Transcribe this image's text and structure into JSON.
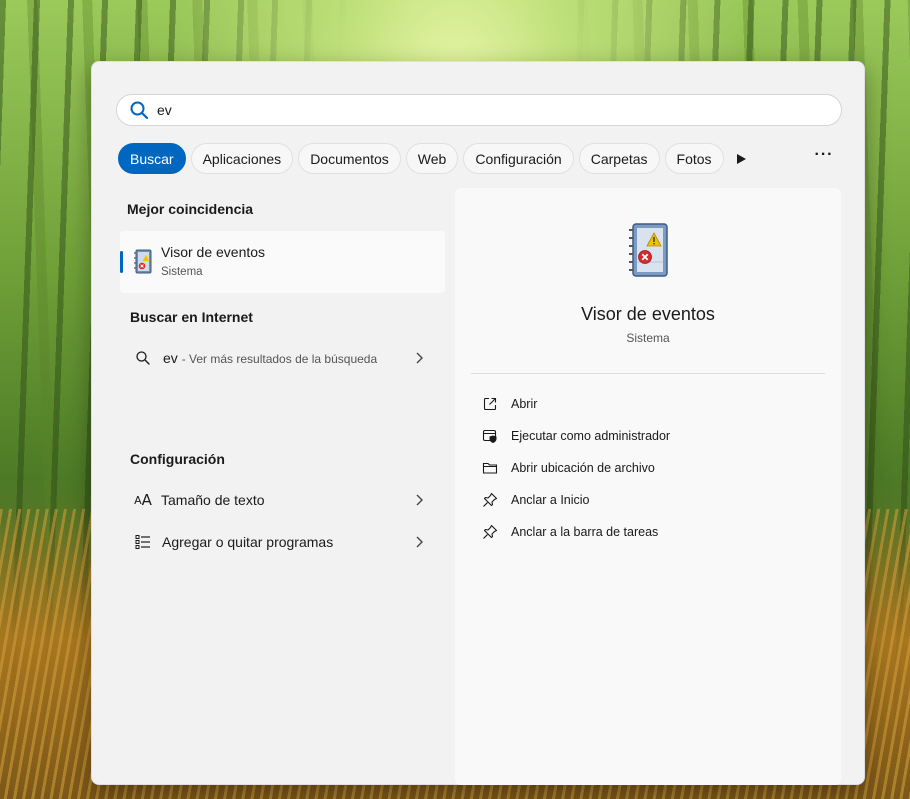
{
  "search": {
    "query": "ev"
  },
  "tabs": [
    {
      "label": "Buscar",
      "active": true
    },
    {
      "label": "Aplicaciones"
    },
    {
      "label": "Documentos"
    },
    {
      "label": "Web"
    },
    {
      "label": "Configuración"
    },
    {
      "label": "Carpetas"
    },
    {
      "label": "Fotos"
    }
  ],
  "left": {
    "best_match_title": "Mejor coincidencia",
    "best_match": {
      "name": "Visor de eventos",
      "subtitle": "Sistema"
    },
    "web_title": "Buscar en Internet",
    "web_query": "ev",
    "web_hint": "- Ver más resultados de la búsqueda",
    "settings_title": "Configuración",
    "settings": [
      {
        "label": "Tamaño de texto",
        "icon": "text-size-icon"
      },
      {
        "label": "Agregar o quitar programas",
        "icon": "app-list-icon"
      }
    ]
  },
  "details": {
    "name": "Visor de eventos",
    "subtitle": "Sistema",
    "actions": [
      {
        "label": "Abrir",
        "icon": "open-external-icon"
      },
      {
        "label": "Ejecutar como administrador",
        "icon": "shield-admin-icon"
      },
      {
        "label": "Abrir ubicación de archivo",
        "icon": "folder-icon"
      },
      {
        "label": "Anclar a Inicio",
        "icon": "pin-icon"
      },
      {
        "label": "Anclar a la barra de tareas",
        "icon": "pin-icon"
      }
    ]
  },
  "colors": {
    "accent": "#0067c0",
    "panel": "#f2f2f2"
  }
}
